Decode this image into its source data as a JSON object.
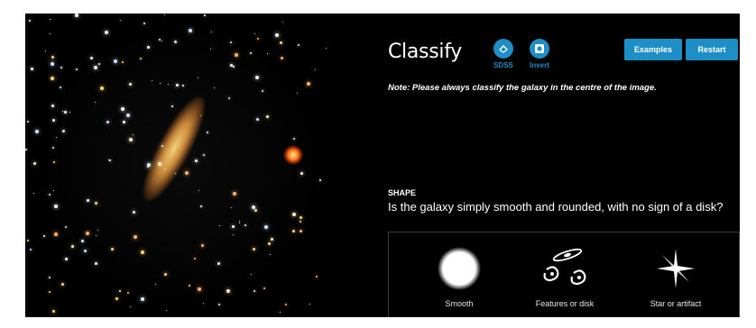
{
  "classify": {
    "title": "Classify",
    "tools": [
      {
        "label": "SDSS",
        "icon": "sdss-icon"
      },
      {
        "label": "Invert",
        "icon": "invert-icon"
      }
    ],
    "buttons": {
      "examples": "Examples",
      "restart": "Restart"
    },
    "note": "Note: Please always classify the galaxy in the centre of the image.",
    "question_label": "SHAPE",
    "question": "Is the galaxy simply smooth and rounded, with no sign of a disk?",
    "answers": [
      {
        "label": "Smooth",
        "icon": "smooth-galaxy-icon"
      },
      {
        "label": "Features or disk",
        "icon": "features-disk-icon"
      },
      {
        "label": "Star or artifact",
        "icon": "star-artifact-icon"
      }
    ]
  },
  "colors": {
    "accent": "#1e8fc6",
    "background": "#000000"
  }
}
